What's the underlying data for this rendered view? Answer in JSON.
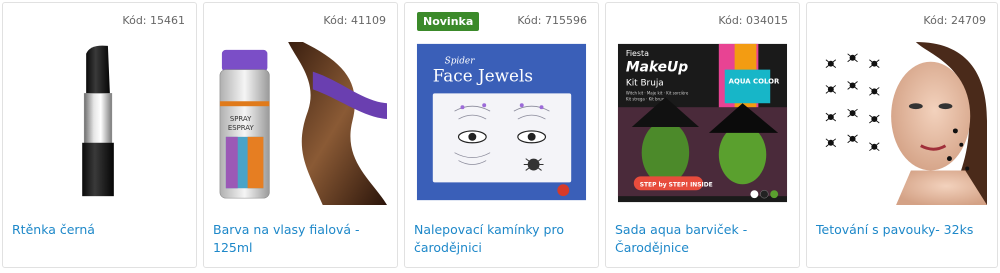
{
  "products": [
    {
      "code": "Kód: 15461",
      "title": "Rtěnka černá",
      "image": "black-lipstick"
    },
    {
      "code": "Kód: 41109",
      "title": "Barva na vlasy fialová - 125ml",
      "image": "purple-hair-spray",
      "can_text": [
        "SPRAY",
        "ESPRAY"
      ]
    },
    {
      "code": "Kód: 715596",
      "title": "Nalepovací kamínky pro čarodějnici",
      "badge": "Novinka",
      "image": "face-jewels",
      "pack_brand": "Spider",
      "pack_title": "Face Jewels"
    },
    {
      "code": "Kód: 034015",
      "title": "Sada aqua barviček - Čarodějnice",
      "image": "witch-makeup-kit",
      "pack_brand": "Fiesta",
      "pack_title": "MakeUp",
      "pack_subtitle": "Kit Bruja",
      "pack_lines": [
        "Witch kit · Maje kit · Kit sorcière",
        "Kit strega · Kit bruxa"
      ],
      "pack_tag": "AQUA COLOR",
      "pack_badge": "STEP by STEP! INSIDE"
    },
    {
      "code": "Kód: 24709",
      "title": "Tetování s pavouky- 32ks",
      "image": "spider-tattoos"
    }
  ],
  "colors": {
    "link": "#1e88c9",
    "badge": "#3b8a2a",
    "border": "#e1e1e1"
  }
}
